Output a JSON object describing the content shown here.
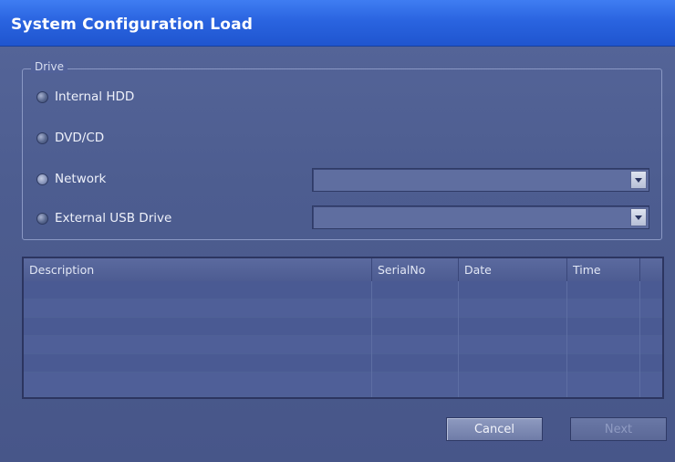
{
  "window": {
    "title": "System Configuration Load"
  },
  "drive": {
    "legend": "Drive",
    "options": [
      {
        "label": "Internal HDD"
      },
      {
        "label": "DVD/CD"
      },
      {
        "label": "Network",
        "dropdown_value": ""
      },
      {
        "label": "External USB Drive",
        "dropdown_value": ""
      }
    ]
  },
  "table": {
    "columns": [
      "Description",
      "SerialNo",
      "Date",
      "Time"
    ],
    "rows": []
  },
  "buttons": {
    "cancel": "Cancel",
    "next": "Next"
  },
  "colors": {
    "titlebar": "#2a64e0",
    "background": "#4d5d90"
  }
}
